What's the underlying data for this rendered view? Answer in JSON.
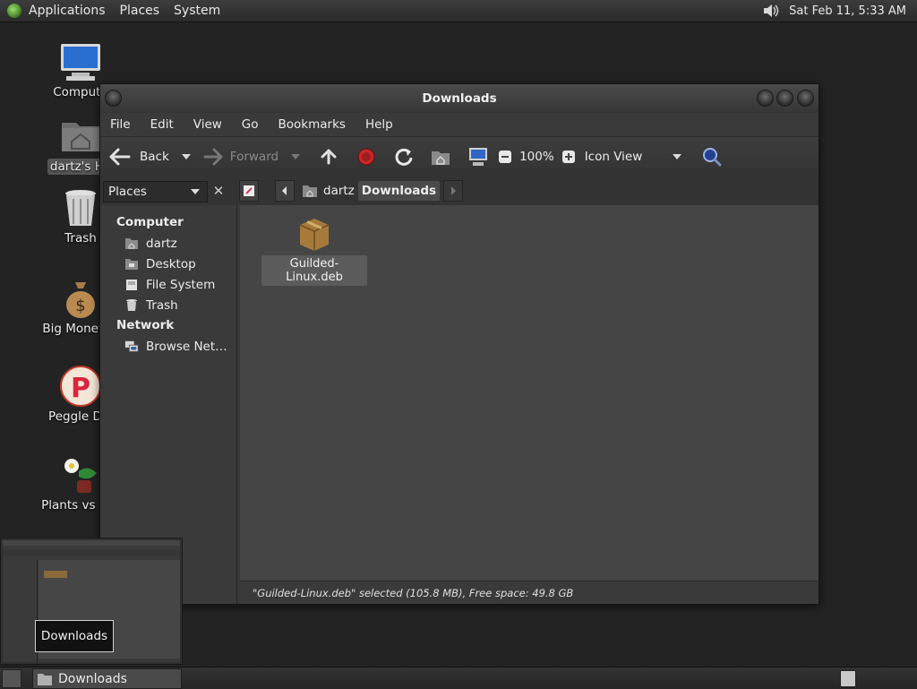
{
  "top_panel": {
    "menus": [
      "Applications",
      "Places",
      "System"
    ],
    "clock": "Sat Feb 11,  5:33 AM"
  },
  "desktop_icons": [
    {
      "label": "Compute"
    },
    {
      "label": "dartz's Ho"
    },
    {
      "label": "Trash"
    },
    {
      "label": "Big Money D"
    },
    {
      "label": "Peggle Del"
    },
    {
      "label": "Plants vs Zor"
    }
  ],
  "window": {
    "title": "Downloads",
    "menu": [
      "File",
      "Edit",
      "View",
      "Go",
      "Bookmarks",
      "Help"
    ],
    "toolbar": {
      "back": "Back",
      "forward": "Forward",
      "zoom": "100%",
      "view_mode": "Icon View"
    },
    "location": {
      "places_label": "Places",
      "crumbs": [
        "dartz",
        "Downloads"
      ]
    },
    "sidebar": {
      "computer_head": "Computer",
      "computer_items": [
        "dartz",
        "Desktop",
        "File System",
        "Trash"
      ],
      "network_head": "Network",
      "network_items": [
        "Browse Net…"
      ]
    },
    "files": [
      {
        "name": "Guilded-Linux.deb"
      }
    ],
    "status": "\"Guilded-Linux.deb\" selected (105.8 MB), Free space: 49.8 GB"
  },
  "preview": {
    "tooltip": "Downloads"
  },
  "bottom_panel": {
    "task": "Downloads"
  }
}
